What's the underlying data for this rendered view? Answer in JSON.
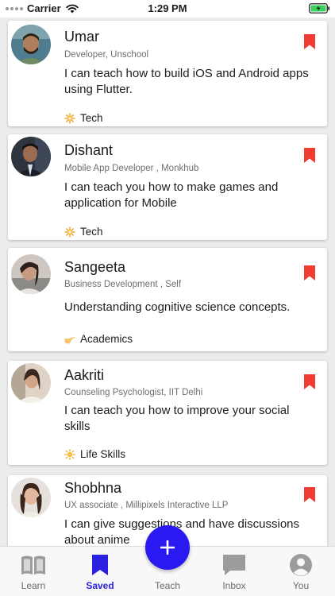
{
  "status_bar": {
    "carrier": "Carrier",
    "time": "1:29 PM"
  },
  "colors": {
    "accent": "#2a19f0",
    "bookmark": "#f03c32",
    "active_tab": "#2a22e0"
  },
  "cards": [
    {
      "name": "Umar",
      "role": "Developer, Unschool",
      "blurb": "I can teach how to build iOS and Android apps using Flutter.",
      "category": "Tech",
      "category_icon": "gear-sun-icon",
      "bookmarked": true
    },
    {
      "name": "Dishant",
      "role": "Mobile App Developer , Monkhub",
      "blurb": "I can teach you how to make games and application for Mobile",
      "category": "Tech",
      "category_icon": "gear-sun-icon",
      "bookmarked": true
    },
    {
      "name": "Sangeeta",
      "role": "Business Development , Self",
      "blurb": "Understanding cognitive science concepts.",
      "category": "Academics",
      "category_icon": "pointing-hand-icon",
      "bookmarked": true
    },
    {
      "name": "Aakriti",
      "role": "Counseling Psychologist, IIT Delhi",
      "blurb": "I can teach you how to improve your social skills",
      "category": "Life Skills",
      "category_icon": "sun-icon",
      "bookmarked": true
    },
    {
      "name": "Shobhna",
      "role": "UX associate , Millipixels Interactive LLP",
      "blurb": "I can give suggestions and have discussions about anime",
      "category": "",
      "category_icon": "",
      "bookmarked": true
    }
  ],
  "tabs": [
    {
      "label": "Learn",
      "icon": "book-icon",
      "active": false
    },
    {
      "label": "Saved",
      "icon": "bookmark-icon",
      "active": true
    },
    {
      "label": "Teach",
      "icon": "plus-icon",
      "active": false
    },
    {
      "label": "Inbox",
      "icon": "chat-icon",
      "active": false
    },
    {
      "label": "You",
      "icon": "profile-icon",
      "active": false
    }
  ]
}
